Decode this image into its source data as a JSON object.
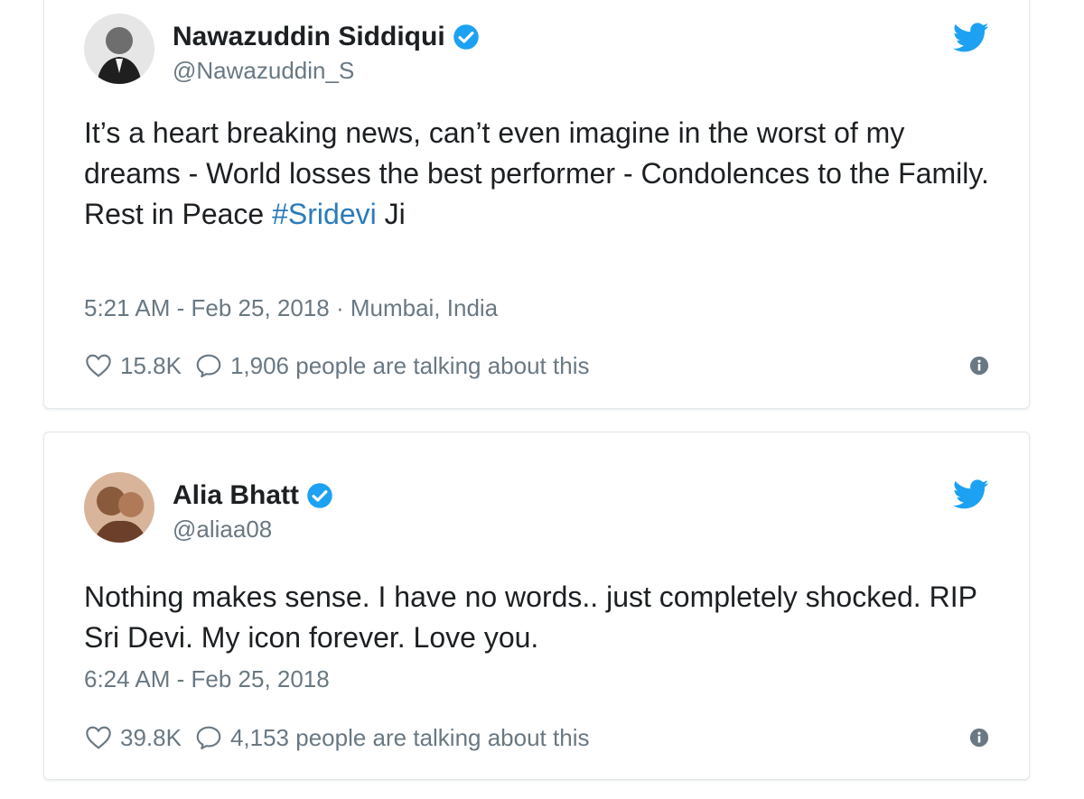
{
  "colors": {
    "twitter_blue": "#1da1f2",
    "hashtag_blue": "#2b7bb9",
    "meta_gray": "#697882",
    "text": "#1c2022"
  },
  "tweets": [
    {
      "display_name": "Nawazuddin Siddiqui",
      "handle": "@Nawazuddin_S",
      "verified_icon": "verified-badge-icon",
      "body_lines": [
        "It’s a heart breaking news, can’t even imagine in the worst of my dreams - World losses the best performer - Condolences to the Family."
      ],
      "body_last_prefix": "Rest in Peace ",
      "hashtag": "#Sridevi",
      "body_last_suffix": " Ji",
      "timestamp": "5:21 AM - Feb 25, 2018 · Mumbai, India",
      "likes": "15.8K",
      "talking": "1,906 people are talking about this"
    },
    {
      "display_name": "Alia Bhatt",
      "handle": "@aliaa08",
      "verified_icon": "verified-badge-icon",
      "body_lines": [
        "Nothing makes sense. I have no words.. just completely shocked. RIP Sri Devi. My icon forever. Love you."
      ],
      "timestamp": "6:24 AM - Feb 25, 2018",
      "likes": "39.8K",
      "talking": "4,153 people are talking about this"
    }
  ]
}
